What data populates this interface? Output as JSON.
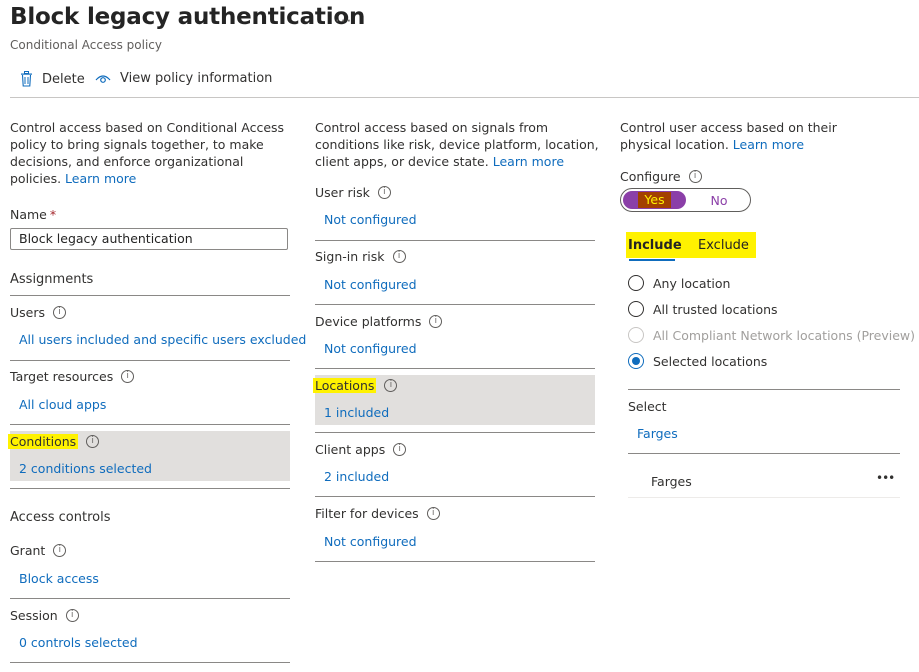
{
  "header": {
    "title": "Block legacy authentication",
    "subtitle": "Conditional Access policy",
    "more": "···"
  },
  "toolbar": {
    "delete_label": "Delete",
    "view_label": "View policy information"
  },
  "left": {
    "description": "Control access based on Conditional Access policy to bring signals together, to make decisions, and enforce organizational policies.",
    "learn_more": "Learn more",
    "name_label": "Name",
    "required_mark": "*",
    "name_value": "Block legacy authentication",
    "assignments_heading": "Assignments",
    "users_label": "Users",
    "users_value": "All users included and specific users excluded",
    "target_label": "Target resources",
    "target_value": "All cloud apps",
    "conditions_label": "Conditions",
    "conditions_value": "2 conditions selected",
    "access_heading": "Access controls",
    "grant_label": "Grant",
    "grant_value": "Block access",
    "session_label": "Session",
    "session_value": "0 controls selected"
  },
  "middle": {
    "description": "Control access based on signals from conditions like risk, device platform, location, client apps, or device state.",
    "learn_more": "Learn more",
    "items": [
      {
        "label": "User risk",
        "value": "Not configured"
      },
      {
        "label": "Sign-in risk",
        "value": "Not configured"
      },
      {
        "label": "Device platforms",
        "value": "Not configured"
      },
      {
        "label": "Locations",
        "value": "1 included"
      },
      {
        "label": "Client apps",
        "value": "2 included"
      },
      {
        "label": "Filter for devices",
        "value": "Not configured"
      }
    ]
  },
  "right": {
    "description": "Control user access based on their physical location.",
    "learn_more": "Learn more",
    "configure_label": "Configure",
    "toggle_yes": "Yes",
    "toggle_no": "No",
    "tab_include": "Include",
    "tab_exclude": "Exclude",
    "options": [
      {
        "label": "Any location",
        "state": "unchecked"
      },
      {
        "label": "All trusted locations",
        "state": "unchecked"
      },
      {
        "label": "All Compliant Network locations (Preview)",
        "state": "disabled"
      },
      {
        "label": "Selected locations",
        "state": "checked"
      }
    ],
    "select_label": "Select",
    "select_value": "Farges",
    "selected_item": "Farges",
    "item_more": "•••"
  },
  "colors": {
    "accent": "#0f6cbd",
    "highlight": "#fff200",
    "selected_row": "#e1dfdd",
    "toggle_on": "#8b3fa8"
  },
  "icons": [
    "trash-icon",
    "eye-icon",
    "info-icon",
    "more-icon"
  ]
}
